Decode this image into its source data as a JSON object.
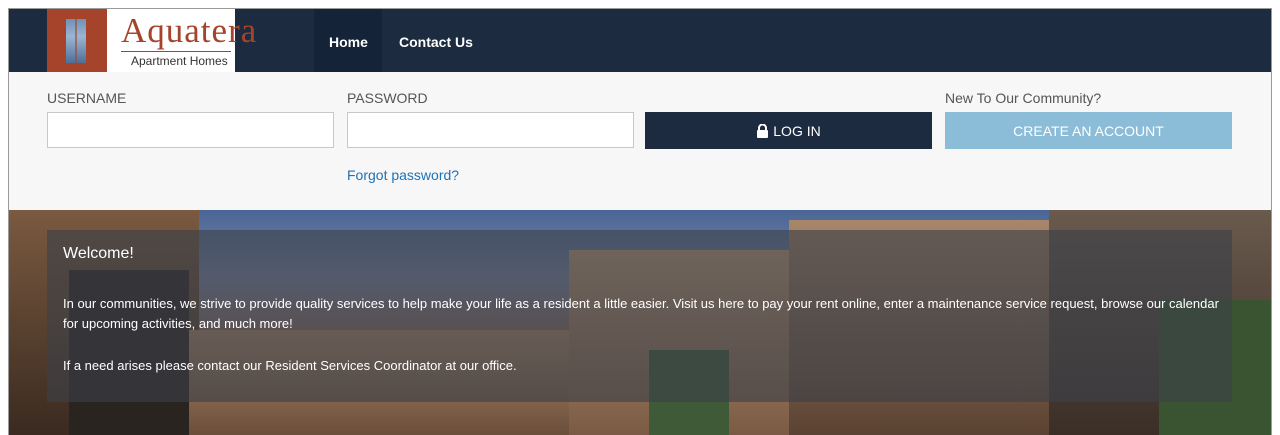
{
  "brand": {
    "name": "Aquatera",
    "tagline": "Apartment Homes"
  },
  "nav": {
    "items": [
      {
        "label": "Home"
      },
      {
        "label": "Contact Us"
      }
    ]
  },
  "login": {
    "username_label": "USERNAME",
    "username_value": "",
    "password_label": "PASSWORD",
    "password_value": "",
    "login_button": "LOG IN",
    "login_icon": "lock-icon",
    "forgot_link": "Forgot password?",
    "new_prompt": "New To Our Community?",
    "create_button": "CREATE AN ACCOUNT"
  },
  "welcome": {
    "heading": "Welcome!",
    "paragraph1": "In our communities, we strive to provide quality services to help make your life as a resident a little easier. Visit us here to pay your rent online, enter a maintenance service request, browse our calendar for upcoming activities, and much more!",
    "paragraph2": "If a need arises please contact our Resident Services Coordinator at our office."
  },
  "colors": {
    "nav_bg": "#1d2b41",
    "brand": "#a5442a",
    "create_button": "#8bbcd8",
    "link": "#1b72b8"
  }
}
